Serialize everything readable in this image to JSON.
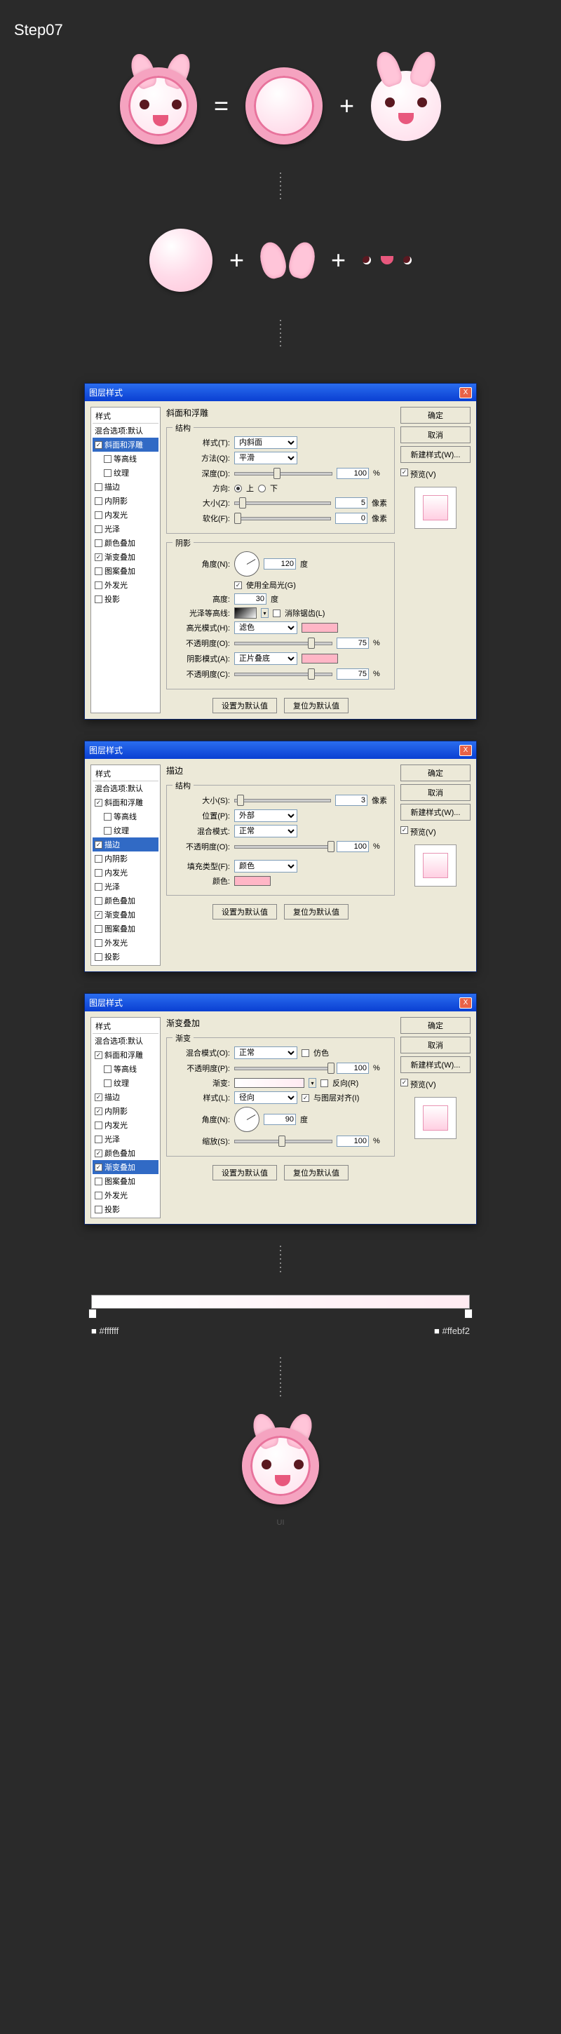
{
  "step_title": "Step07",
  "operators": {
    "eq": "=",
    "plus": "+"
  },
  "dialog_title": "图层样式",
  "close_x": "X",
  "sidebar": {
    "header": "样式",
    "blend": "混合选项:默认",
    "items": [
      {
        "key": "bevel",
        "label": "斜面和浮雕"
      },
      {
        "key": "contour",
        "label": "等高线",
        "sub": true
      },
      {
        "key": "texture",
        "label": "纹理",
        "sub": true
      },
      {
        "key": "stroke",
        "label": "描边"
      },
      {
        "key": "innerShadow",
        "label": "内阴影"
      },
      {
        "key": "innerGlow",
        "label": "内发光"
      },
      {
        "key": "satin",
        "label": "光泽"
      },
      {
        "key": "colorOverlay",
        "label": "颜色叠加"
      },
      {
        "key": "gradientOverlay",
        "label": "渐变叠加"
      },
      {
        "key": "patternOverlay",
        "label": "图案叠加"
      },
      {
        "key": "outerGlow",
        "label": "外发光"
      },
      {
        "key": "dropShadow",
        "label": "投影"
      }
    ]
  },
  "right": {
    "ok": "确定",
    "cancel": "取消",
    "newstyle": "新建样式(W)...",
    "preview": "预览(V)"
  },
  "bevel": {
    "title": "斜面和浮雕",
    "structure": "结构",
    "style_l": "样式(T):",
    "style_v": "内斜面",
    "tech_l": "方法(Q):",
    "tech_v": "平滑",
    "depth_l": "深度(D):",
    "depth_v": "100",
    "pct": "%",
    "dir_l": "方向:",
    "up": "上",
    "down": "下",
    "size_l": "大小(Z):",
    "size_v": "5",
    "px": "像素",
    "soften_l": "软化(F):",
    "soften_v": "0",
    "shading": "阴影",
    "angle_l": "角度(N):",
    "angle_v": "120",
    "deg": "度",
    "global": "使用全局光(G)",
    "alt_l": "高度:",
    "alt_v": "30",
    "gloss_l": "光泽等高线:",
    "anti": "消除锯齿(L)",
    "hi_l": "高光模式(H):",
    "hi_v": "滤色",
    "hio_l": "不透明度(O):",
    "hio_v": "75",
    "sh_l": "阴影模式(A):",
    "sh_v": "正片叠底",
    "sho_l": "不透明度(C):",
    "sho_v": "75",
    "default1": "设置为默认值",
    "default2": "复位为默认值"
  },
  "stroke": {
    "title": "描边",
    "structure": "结构",
    "size_l": "大小(S):",
    "size_v": "3",
    "px": "像素",
    "pos_l": "位置(P):",
    "pos_v": "外部",
    "blend_l": "混合模式:",
    "blend_v": "正常",
    "opa_l": "不透明度(O):",
    "opa_v": "100",
    "pct": "%",
    "fill_l": "填充类型(F):",
    "fill_v": "颜色",
    "color_l": "颜色:",
    "default1": "设置为默认值",
    "default2": "复位为默认值"
  },
  "grad": {
    "title": "渐变叠加",
    "section": "渐变",
    "blend_l": "混合模式(O):",
    "blend_v": "正常",
    "dither": "仿色",
    "opa_l": "不透明度(P):",
    "opa_v": "100",
    "pct": "%",
    "grad_l": "渐变:",
    "rev": "反向(R)",
    "style_l": "样式(L):",
    "style_v": "径向",
    "align": "与图层对齐(I)",
    "angle_l": "角度(N):",
    "angle_v": "90",
    "deg": "度",
    "scale_l": "缩放(S):",
    "scale_v": "100",
    "default1": "设置为默认值",
    "default2": "复位为默认值"
  },
  "gradient_stops": {
    "left": "#ffffff",
    "right": "#ffebf2"
  },
  "watermark": "UI"
}
